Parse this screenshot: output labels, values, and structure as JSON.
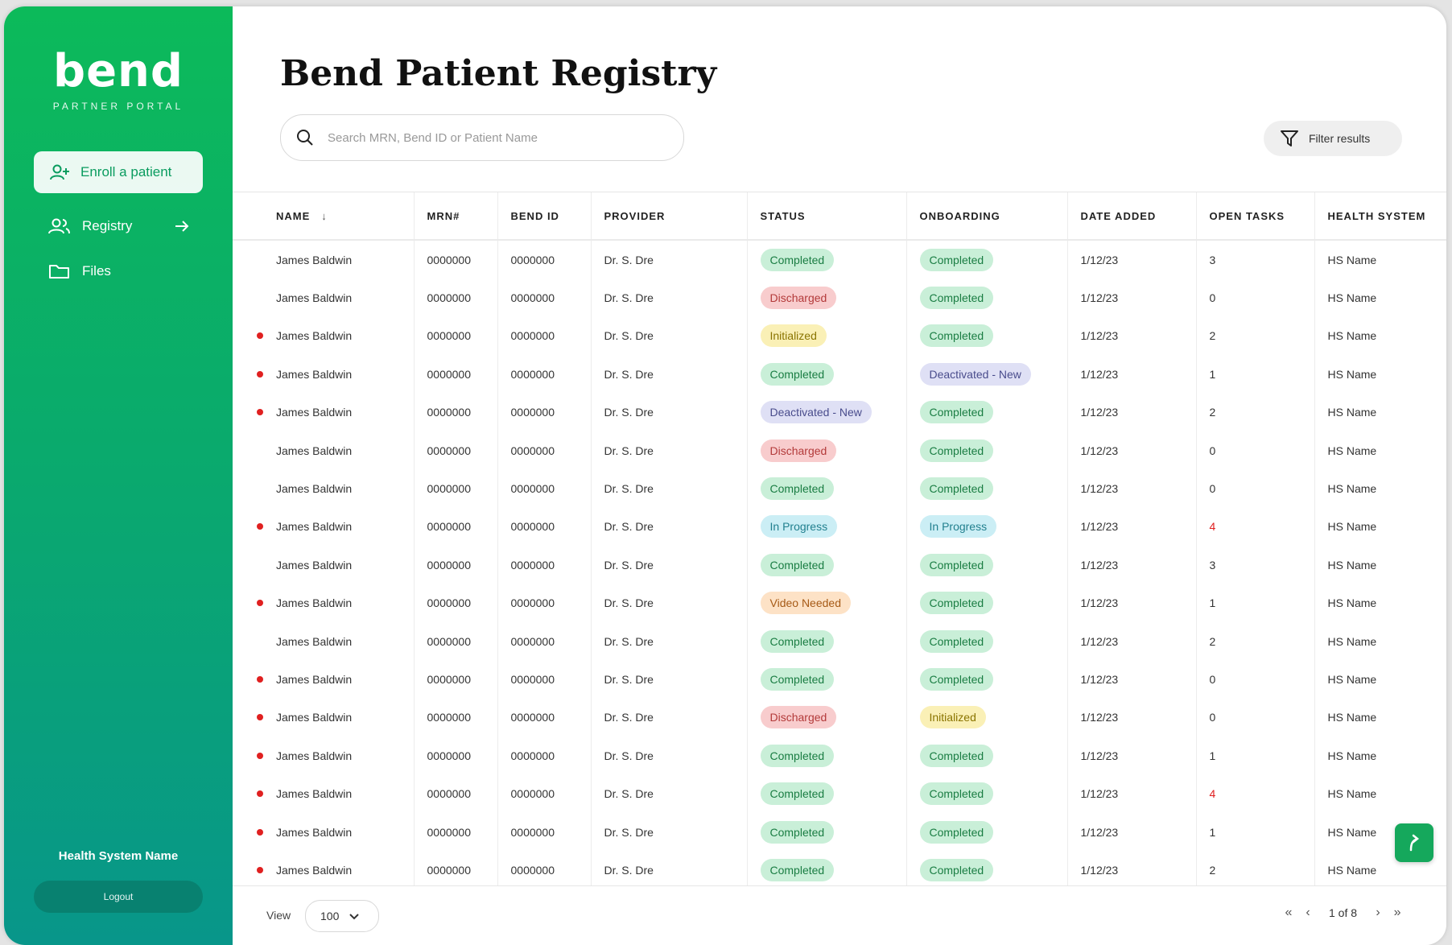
{
  "sidebar": {
    "logo": "bend",
    "logo_sub": "PARTNER PORTAL",
    "enroll_label": "Enroll a patient",
    "nav": [
      {
        "label": "Registry",
        "icon": "users-icon"
      },
      {
        "label": "Files",
        "icon": "folder-icon"
      }
    ],
    "org_name": "Health System Name",
    "logout_label": "Logout"
  },
  "header": {
    "title": "Bend Patient Registry",
    "search_placeholder": "Search MRN, Bend ID or Patient Name",
    "filter_label": "Filter results"
  },
  "table": {
    "columns": [
      "NAME",
      "MRN#",
      "BEND ID",
      "PROVIDER",
      "STATUS",
      "ONBOARDING",
      "DATE ADDED",
      "OPEN TASKS",
      "HEALTH SYSTEM"
    ],
    "sort_column": "NAME",
    "rows": [
      {
        "flag": false,
        "name": "James Baldwin",
        "mrn": "0000000",
        "bend_id": "0000000",
        "provider": "Dr. S. Dre",
        "status": "Completed",
        "onboarding": "Completed",
        "date": "1/12/23",
        "tasks": "3",
        "hs": "HS Name"
      },
      {
        "flag": false,
        "name": "James Baldwin",
        "mrn": "0000000",
        "bend_id": "0000000",
        "provider": "Dr. S. Dre",
        "status": "Discharged",
        "onboarding": "Completed",
        "date": "1/12/23",
        "tasks": "0",
        "hs": "HS Name"
      },
      {
        "flag": true,
        "name": "James Baldwin",
        "mrn": "0000000",
        "bend_id": "0000000",
        "provider": "Dr. S. Dre",
        "status": "Initialized",
        "onboarding": "Completed",
        "date": "1/12/23",
        "tasks": "2",
        "hs": "HS Name"
      },
      {
        "flag": true,
        "name": "James Baldwin",
        "mrn": "0000000",
        "bend_id": "0000000",
        "provider": "Dr. S. Dre",
        "status": "Completed",
        "onboarding": "Deactivated - New",
        "date": "1/12/23",
        "tasks": "1",
        "hs": "HS Name"
      },
      {
        "flag": true,
        "name": "James Baldwin",
        "mrn": "0000000",
        "bend_id": "0000000",
        "provider": "Dr. S. Dre",
        "status": "Deactivated - New",
        "onboarding": "Completed",
        "date": "1/12/23",
        "tasks": "2",
        "hs": "HS Name"
      },
      {
        "flag": false,
        "name": "James Baldwin",
        "mrn": "0000000",
        "bend_id": "0000000",
        "provider": "Dr. S. Dre",
        "status": "Discharged",
        "onboarding": "Completed",
        "date": "1/12/23",
        "tasks": "0",
        "hs": "HS Name"
      },
      {
        "flag": false,
        "name": "James Baldwin",
        "mrn": "0000000",
        "bend_id": "0000000",
        "provider": "Dr. S. Dre",
        "status": "Completed",
        "onboarding": "Completed",
        "date": "1/12/23",
        "tasks": "0",
        "hs": "HS Name"
      },
      {
        "flag": true,
        "name": "James Baldwin",
        "mrn": "0000000",
        "bend_id": "0000000",
        "provider": "Dr. S. Dre",
        "status": "In Progress",
        "onboarding": "In Progress",
        "date": "1/12/23",
        "tasks": "4",
        "hs": "HS Name"
      },
      {
        "flag": false,
        "name": "James Baldwin",
        "mrn": "0000000",
        "bend_id": "0000000",
        "provider": "Dr. S. Dre",
        "status": "Completed",
        "onboarding": "Completed",
        "date": "1/12/23",
        "tasks": "3",
        "hs": "HS Name"
      },
      {
        "flag": true,
        "name": "James Baldwin",
        "mrn": "0000000",
        "bend_id": "0000000",
        "provider": "Dr. S. Dre",
        "status": "Video Needed",
        "onboarding": "Completed",
        "date": "1/12/23",
        "tasks": "1",
        "hs": "HS Name"
      },
      {
        "flag": false,
        "name": "James Baldwin",
        "mrn": "0000000",
        "bend_id": "0000000",
        "provider": "Dr. S. Dre",
        "status": "Completed",
        "onboarding": "Completed",
        "date": "1/12/23",
        "tasks": "2",
        "hs": "HS Name"
      },
      {
        "flag": true,
        "name": "James Baldwin",
        "mrn": "0000000",
        "bend_id": "0000000",
        "provider": "Dr. S. Dre",
        "status": "Completed",
        "onboarding": "Completed",
        "date": "1/12/23",
        "tasks": "0",
        "hs": "HS Name"
      },
      {
        "flag": true,
        "name": "James Baldwin",
        "mrn": "0000000",
        "bend_id": "0000000",
        "provider": "Dr. S. Dre",
        "status": "Discharged",
        "onboarding": "Initialized",
        "date": "1/12/23",
        "tasks": "0",
        "hs": "HS Name"
      },
      {
        "flag": true,
        "name": "James Baldwin",
        "mrn": "0000000",
        "bend_id": "0000000",
        "provider": "Dr. S. Dre",
        "status": "Completed",
        "onboarding": "Completed",
        "date": "1/12/23",
        "tasks": "1",
        "hs": "HS Name"
      },
      {
        "flag": true,
        "name": "James Baldwin",
        "mrn": "0000000",
        "bend_id": "0000000",
        "provider": "Dr. S. Dre",
        "status": "Completed",
        "onboarding": "Completed",
        "date": "1/12/23",
        "tasks": "4",
        "hs": "HS Name"
      },
      {
        "flag": true,
        "name": "James Baldwin",
        "mrn": "0000000",
        "bend_id": "0000000",
        "provider": "Dr. S. Dre",
        "status": "Completed",
        "onboarding": "Completed",
        "date": "1/12/23",
        "tasks": "1",
        "hs": "HS Name"
      },
      {
        "flag": true,
        "name": "James Baldwin",
        "mrn": "0000000",
        "bend_id": "0000000",
        "provider": "Dr. S. Dre",
        "status": "Completed",
        "onboarding": "Completed",
        "date": "1/12/23",
        "tasks": "2",
        "hs": "HS Name"
      }
    ]
  },
  "footer": {
    "view_label": "View",
    "page_size": "100",
    "page_info": "1 of 8"
  },
  "colors": {
    "brand_green": "#0cba5a",
    "brand_teal": "#08968a",
    "alert_red": "#e02020"
  }
}
